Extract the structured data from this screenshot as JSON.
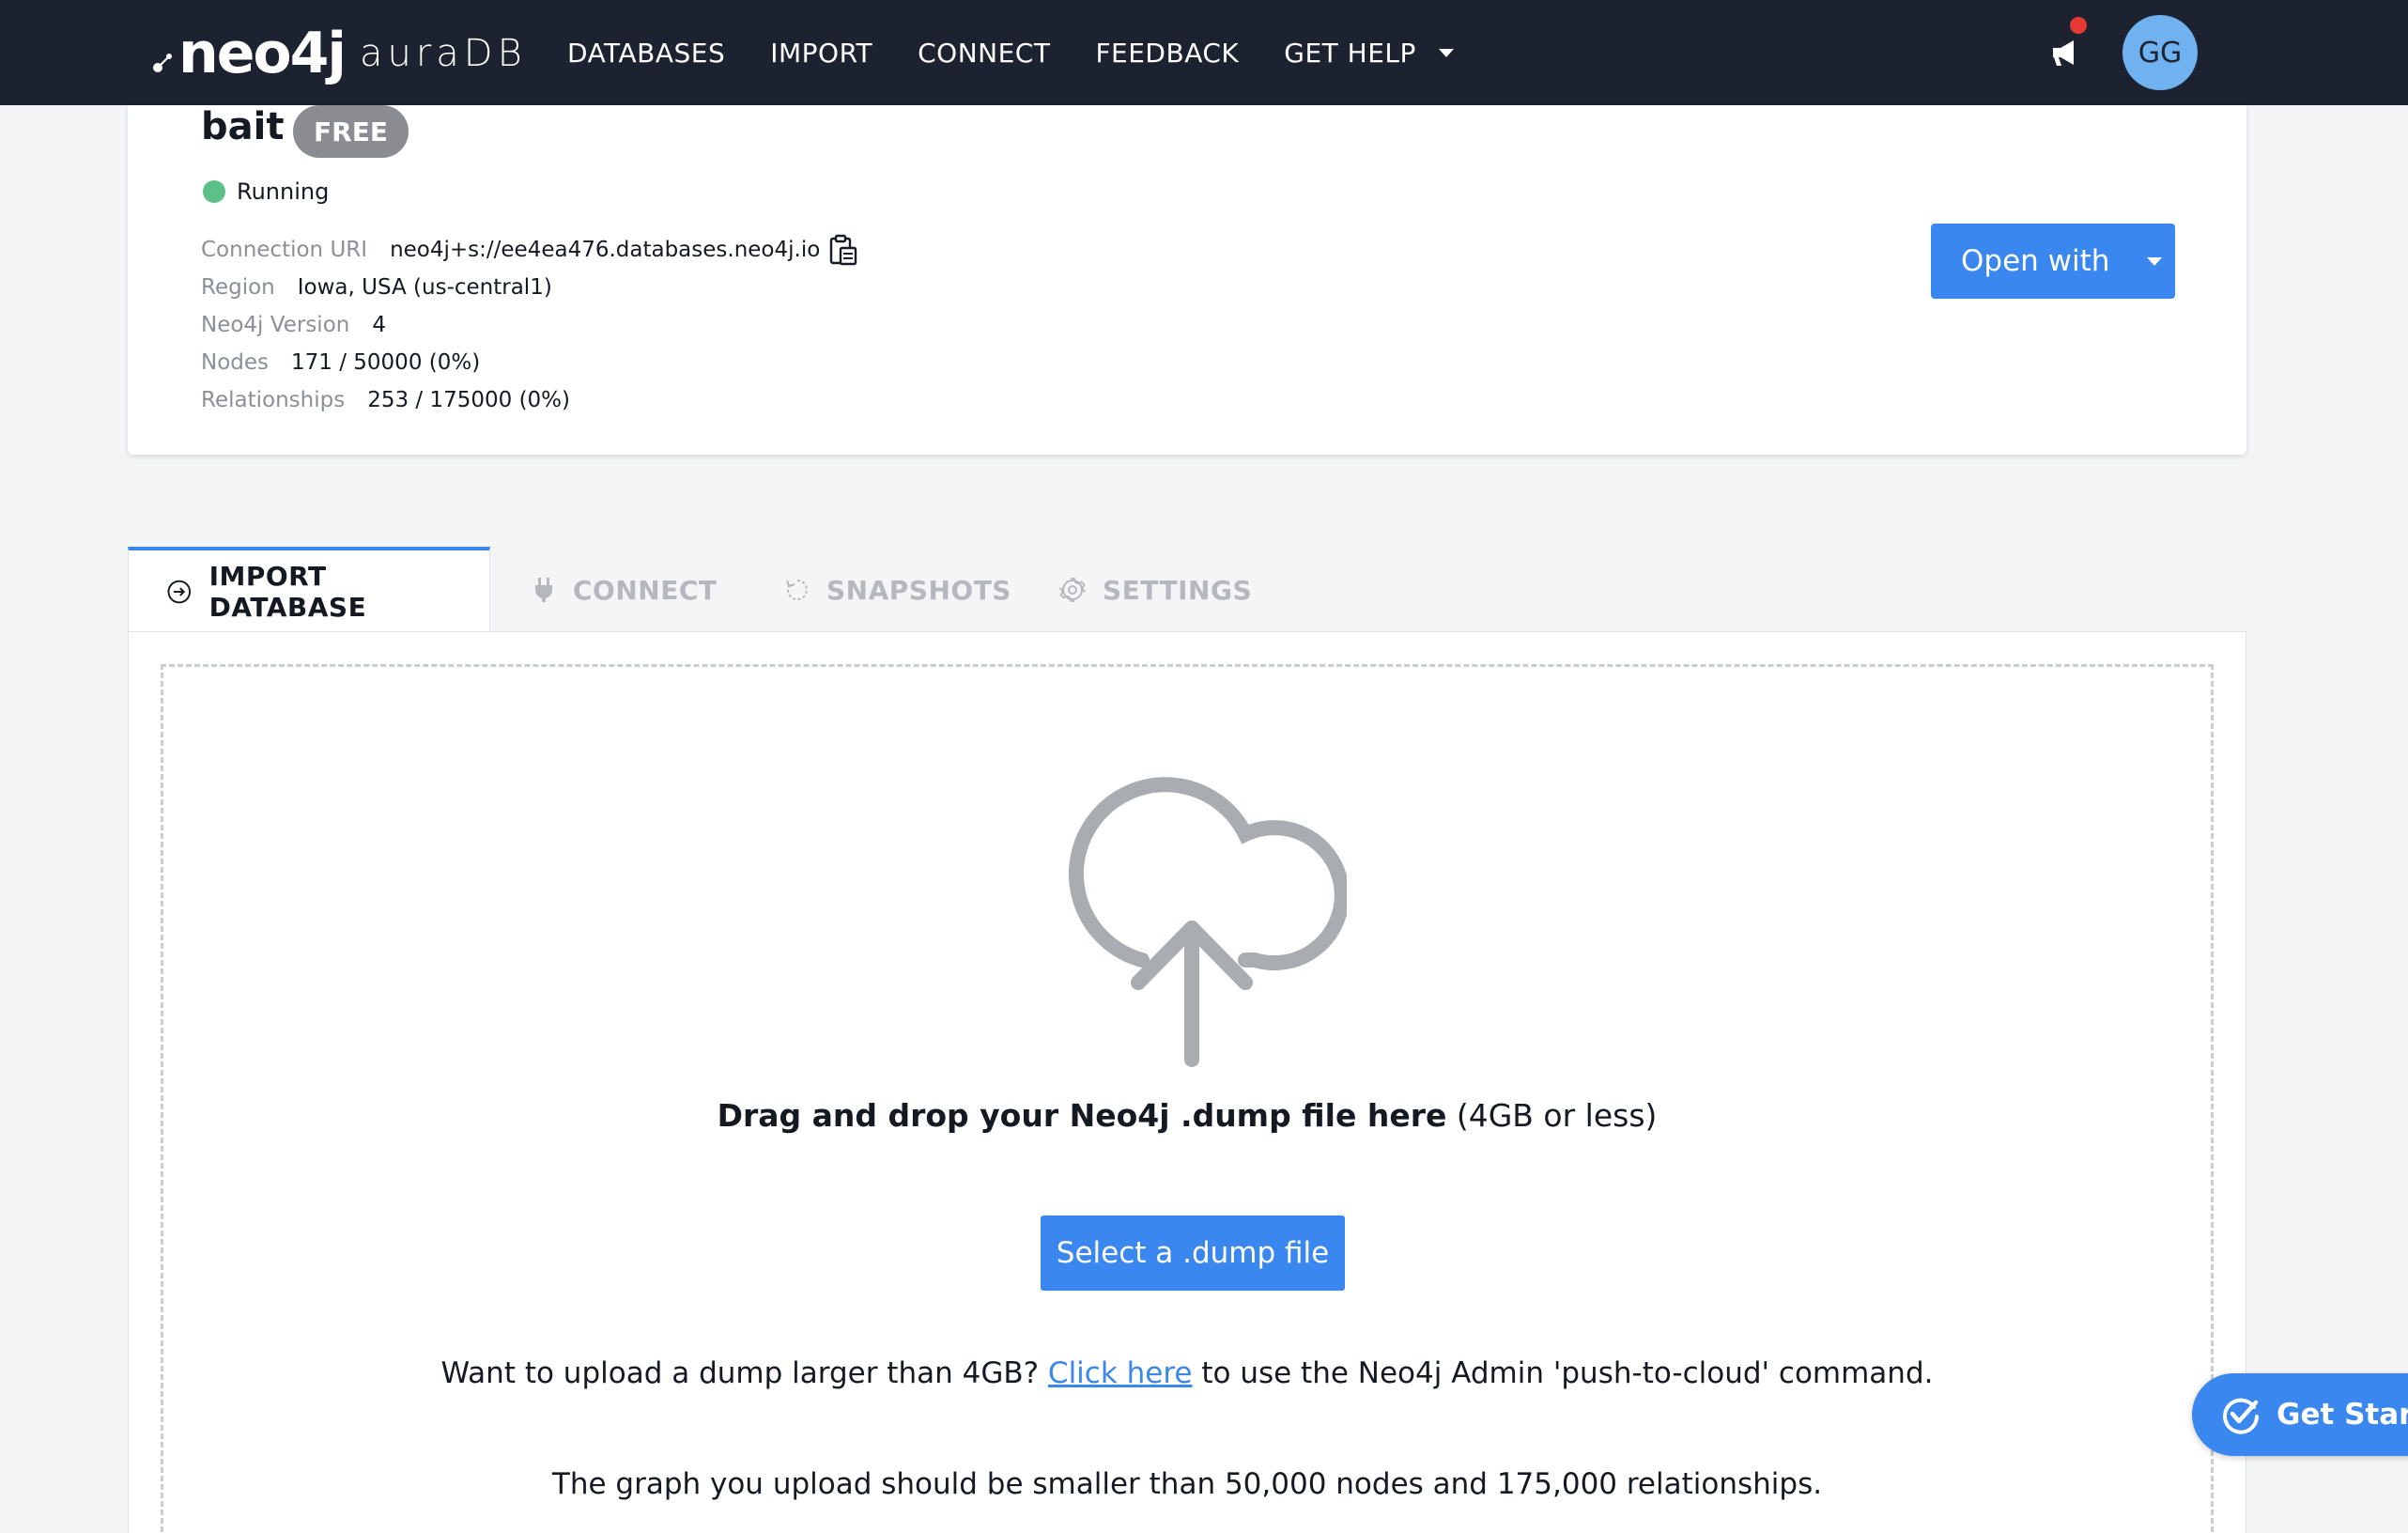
{
  "nav": {
    "logo_mark": "neo4j",
    "logo_product": "auraDB",
    "links": [
      "DATABASES",
      "IMPORT",
      "CONNECT",
      "FEEDBACK"
    ],
    "help_label": "GET HELP",
    "avatar_initials": "GG"
  },
  "database": {
    "name": "bait",
    "tier": "FREE",
    "status": "Running",
    "details": [
      {
        "label": "Connection URI",
        "value": "neo4j+s://ee4ea476.databases.neo4j.io"
      },
      {
        "label": "Region",
        "value": "Iowa, USA (us-central1)"
      },
      {
        "label": "Neo4j Version",
        "value": "4"
      },
      {
        "label": "Nodes",
        "value": "171 / 50000 (0%)"
      },
      {
        "label": "Relationships",
        "value": "253 / 175000 (0%)"
      }
    ],
    "open_with_label": "Open with"
  },
  "tabs": [
    {
      "label": "IMPORT DATABASE",
      "icon": "arrow-circle-icon",
      "active": true
    },
    {
      "label": "CONNECT",
      "icon": "plug-icon",
      "active": false
    },
    {
      "label": "SNAPSHOTS",
      "icon": "refresh-icon",
      "active": false
    },
    {
      "label": "SETTINGS",
      "icon": "gear-icon",
      "active": false
    }
  ],
  "import": {
    "drag_bold": "Drag and drop your Neo4j .dump file here",
    "drag_suffix": "(4GB or less)",
    "select_button": "Select a .dump file",
    "hint_before": "Want to upload a dump larger than 4GB?",
    "hint_link": "Click here",
    "hint_after": "to use the Neo4j Admin 'push-to-cloud' command.",
    "limit_text": "The graph you upload should be smaller than 50,000 nodes and 175,000 relationships."
  },
  "get_started_label": "Get Started",
  "colors": {
    "nav_bg": "#1c2230",
    "accent": "#3a87f0",
    "running": "#5bc08a",
    "tier_badge": "#8a8c91",
    "notification_dot": "#e53935"
  }
}
